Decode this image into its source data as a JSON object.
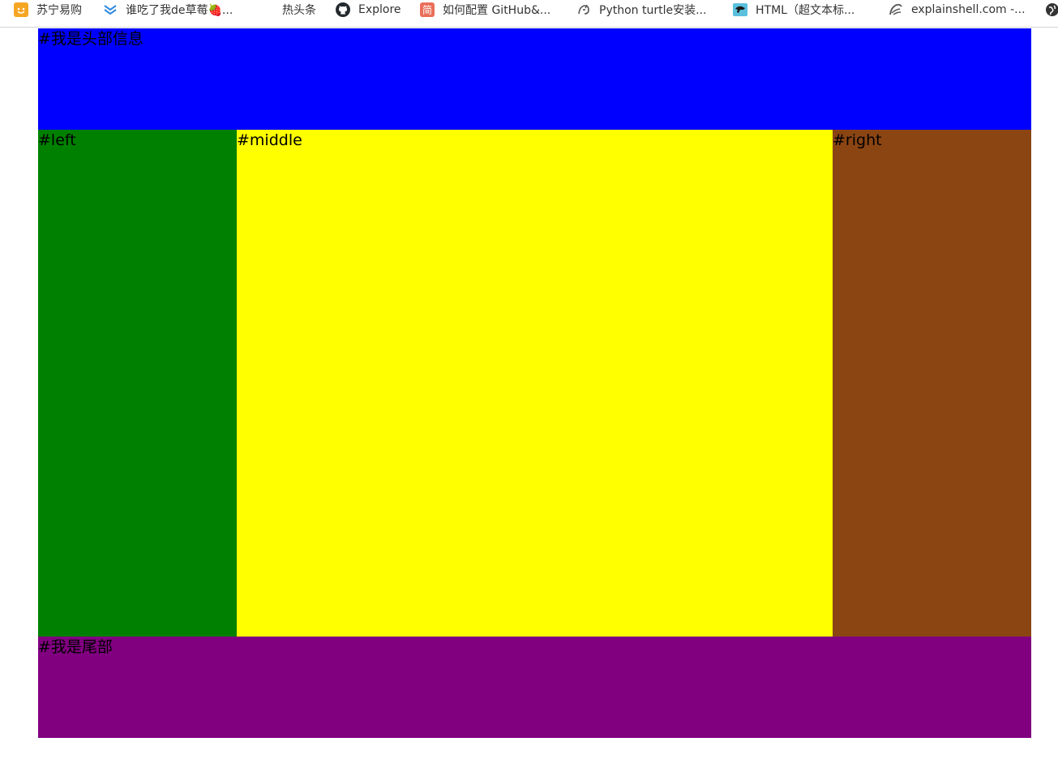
{
  "bookmarks": [
    {
      "label": "苏宁易购",
      "icon": "suning-icon",
      "color": "#f5a623"
    },
    {
      "label": "谁吃了我de草莓🍓...",
      "icon": "chevron-stack-icon",
      "color": "#2f8ae0"
    },
    {
      "label": "热头条",
      "icon": "",
      "color": ""
    },
    {
      "label": "Explore",
      "icon": "github-icon",
      "color": "#24292e"
    },
    {
      "label": "如何配置 GitHub&...",
      "icon": "jianshu-icon",
      "color": "#ea6f5a"
    },
    {
      "label": "Python turtle安装...",
      "icon": "turtle-icon",
      "color": "#555555"
    },
    {
      "label": "HTML（超文本标...",
      "icon": "puma-icon",
      "color": "#5bc0de"
    },
    {
      "label": "explainshell.com -...",
      "icon": "shell-icon",
      "color": "#555555"
    },
    {
      "label": "",
      "icon": "globe-icon",
      "color": "#333333"
    }
  ],
  "layout": {
    "header": {
      "label": "#我是头部信息",
      "color": "#0000ff"
    },
    "left": {
      "label": "#left",
      "color": "#008000"
    },
    "middle": {
      "label": "#middle",
      "color": "#ffff00"
    },
    "right": {
      "label": "#right",
      "color": "#8b4513"
    },
    "footer": {
      "label": "#我是尾部",
      "color": "#800080"
    }
  }
}
